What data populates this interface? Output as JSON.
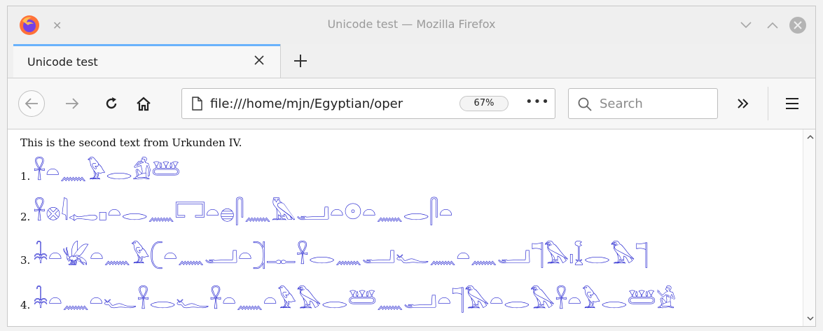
{
  "window": {
    "title": "Unicode test — Mozilla Firefox"
  },
  "tabs": [
    {
      "label": "Unicode test",
      "active": true
    }
  ],
  "navbar": {
    "url": "file:///home/mjn/Egyptian/oper",
    "zoom": "67%",
    "page_actions": "•••",
    "search_placeholder": "Search"
  },
  "content": {
    "intro": "This is the second text from Urkunden IV.",
    "lines": [
      {
        "number": "1.",
        "glyphs": "𓋹𓏏𓈖𓅱𓂋𓀁𓆷"
      },
      {
        "number": "2.",
        "glyphs": "𓋹𓊖𓇋𓉻𓊪𓏏𓂋𓈖𓉐𓏏𓐍𓋴𓈖𓅓𓂝𓏏𓇳𓏏𓈖𓂋𓋴𓏏"
      },
      {
        "number": "3.",
        "glyphs": "𓇓𓏏𓆤𓏏𓈖𓅱𓍹𓏏𓈖𓂝𓏏𓍺𓊃𓋹𓂋𓈖𓂝𓆑𓈖𓏏𓈖𓂝𓊹𓅃𓏤𓆼𓂋𓅃𓊹"
      },
      {
        "number": "4.",
        "glyphs": "𓇓𓏏𓈖𓏏𓆑𓋹𓂋𓆑𓋹𓏏𓈖𓏏𓅱𓅃𓂋𓆷𓈖𓂝𓏏𓊹𓅃𓏏𓂋𓅃𓋹𓏏𓅱𓂋𓆷𓀀"
      }
    ]
  },
  "colors": {
    "glyph": "#1a1acd",
    "tab_accent": "#0a84ff"
  }
}
